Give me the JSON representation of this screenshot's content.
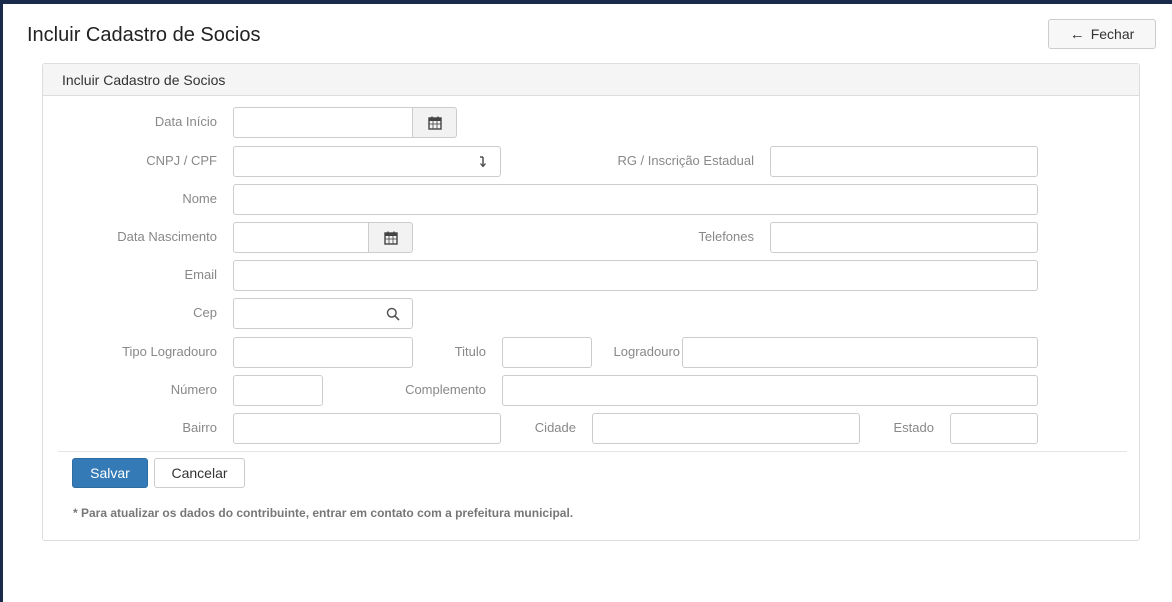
{
  "page": {
    "title": "Incluir Cadastro de Socios",
    "close_label": "Fechar",
    "close_icon": "arrow-left-icon"
  },
  "panel": {
    "title": "Incluir Cadastro de Socios"
  },
  "form": {
    "data_inicio": {
      "label": "Data Início",
      "value": "",
      "icon": "calendar-icon"
    },
    "cnpj_cpf": {
      "label": "CNPJ / CPF",
      "value": "",
      "icon": "arrow-down-icon"
    },
    "rg_ie": {
      "label": "RG / Inscrição Estadual",
      "value": ""
    },
    "nome": {
      "label": "Nome",
      "value": ""
    },
    "data_nascimento": {
      "label": "Data Nascimento",
      "value": "",
      "icon": "calendar-icon"
    },
    "telefones": {
      "label": "Telefones",
      "value": ""
    },
    "email": {
      "label": "Email",
      "value": ""
    },
    "cep": {
      "label": "Cep",
      "value": "",
      "icon": "search-icon"
    },
    "tipo_logradouro": {
      "label": "Tipo Logradouro",
      "value": ""
    },
    "titulo": {
      "label": "Titulo",
      "value": ""
    },
    "logradouro": {
      "label": "Logradouro",
      "value": ""
    },
    "numero": {
      "label": "Número",
      "value": ""
    },
    "complemento": {
      "label": "Complemento",
      "value": ""
    },
    "bairro": {
      "label": "Bairro",
      "value": ""
    },
    "cidade": {
      "label": "Cidade",
      "value": ""
    },
    "estado": {
      "label": "Estado",
      "value": ""
    }
  },
  "actions": {
    "save_label": "Salvar",
    "cancel_label": "Cancelar"
  },
  "note": "* Para atualizar os dados do contribuinte, entrar em contato com a prefeitura municipal.",
  "colors": {
    "primary": "#337ab7",
    "label": "#888888",
    "border": "#cccccc",
    "frame": "#1a2a4a"
  }
}
